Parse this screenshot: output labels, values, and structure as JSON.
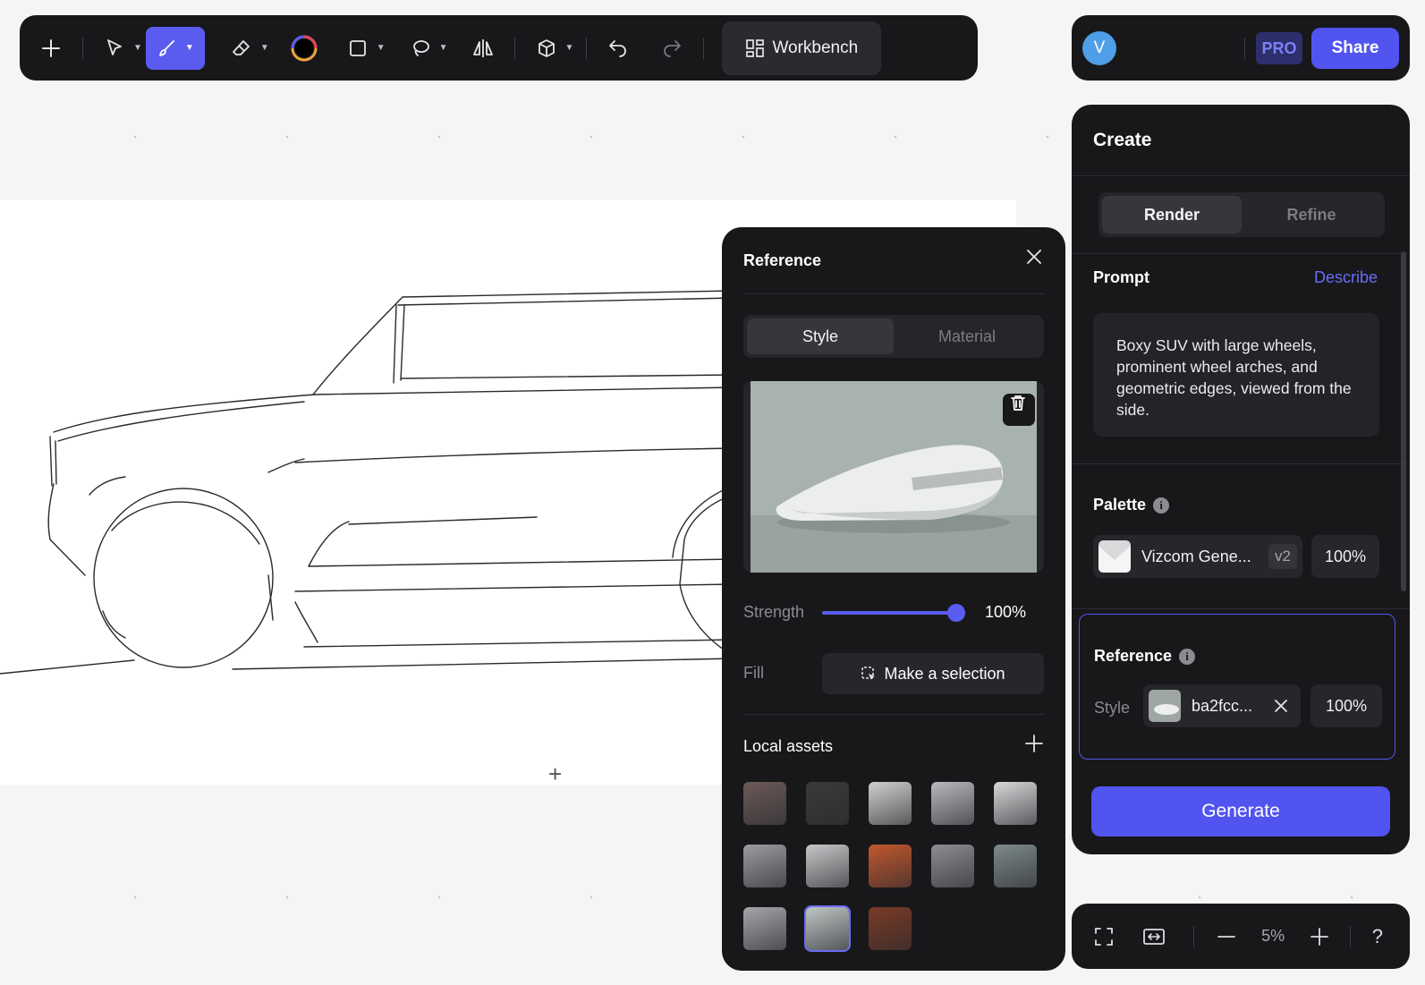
{
  "toolbar": {
    "tools": [
      "add-icon",
      "select-icon",
      "brush-icon",
      "eraser-icon",
      "color-icon",
      "rectangle-icon",
      "lasso-icon",
      "mirror-icon",
      "cube-icon",
      "undo-icon",
      "redo-icon"
    ],
    "active_tool": "brush-icon",
    "workbench_label": "Workbench",
    "accent": "#5a5cf0"
  },
  "user": {
    "avatar_initial": "V",
    "pro_label": "PRO",
    "share_label": "Share"
  },
  "create": {
    "title": "Create",
    "tabs": [
      {
        "label": "Render",
        "active": true
      },
      {
        "label": "Refine",
        "active": false
      }
    ],
    "prompt_label": "Prompt",
    "describe_label": "Describe",
    "prompt_text": "Boxy SUV with large wheels, prominent wheel arches, and geometric edges, viewed from the side.",
    "palette_label": "Palette",
    "palette": {
      "name": "Vizcom Gene...",
      "version": "v2",
      "strength": "100%"
    },
    "reference_label": "Reference",
    "reference": {
      "type_label": "Style",
      "name": "ba2fcc...",
      "strength": "100%"
    },
    "generate_label": "Generate"
  },
  "reference_panel": {
    "title": "Reference",
    "tabs": [
      {
        "label": "Style",
        "active": true
      },
      {
        "label": "Material",
        "active": false
      }
    ],
    "strength_label": "Strength",
    "strength_value": "100%",
    "strength_fraction": 1.0,
    "fill_label": "Fill",
    "make_selection_label": "Make a selection",
    "local_assets_label": "Local assets",
    "assets": [
      {
        "name": "asset-1",
        "color": "#6b5a58"
      },
      {
        "name": "asset-2",
        "color": "#3a3a3a"
      },
      {
        "name": "asset-3",
        "color": "#cfcfcf"
      },
      {
        "name": "asset-4",
        "color": "#b9b9bd"
      },
      {
        "name": "asset-5",
        "color": "#d8d8da"
      },
      {
        "name": "asset-6",
        "color": "#9c9ca0"
      },
      {
        "name": "asset-7",
        "color": "#c7c7c9"
      },
      {
        "name": "asset-8",
        "color": "#c2572e"
      },
      {
        "name": "asset-9",
        "color": "#8e8e92"
      },
      {
        "name": "asset-10",
        "color": "#7d8a8c"
      },
      {
        "name": "asset-11",
        "color": "#a4a6a8"
      },
      {
        "name": "asset-12",
        "color": "#bfc6c5",
        "selected": true
      },
      {
        "name": "asset-13",
        "color": "#7a3a26"
      }
    ]
  },
  "zoom": {
    "value": "5%",
    "help": "?"
  }
}
